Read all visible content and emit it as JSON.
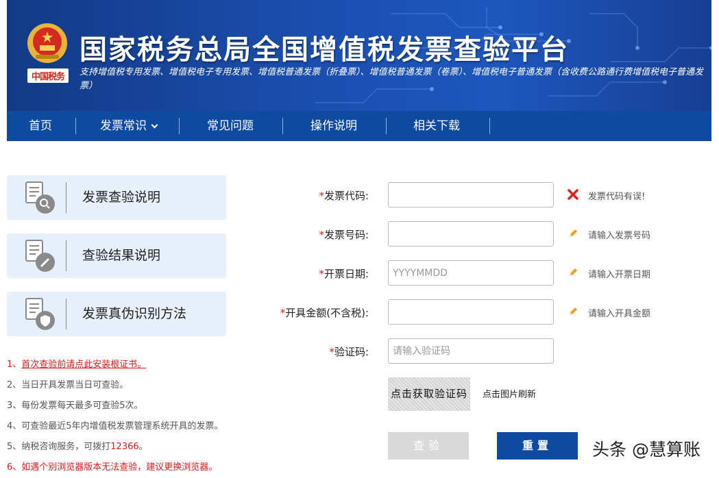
{
  "header": {
    "seal_text": "中国税务",
    "title": "国家税务总局全国增值税发票查验平台",
    "subtitle": "支持增值税专用发票、增值税电子专用发票、增值税普通发票（折叠票）、增值税普通发票（卷票）、增值税电子普通发票（含收费公路通行费增值税电子普通发票）"
  },
  "nav": {
    "items": [
      {
        "label": "首页"
      },
      {
        "label": "发票常识"
      },
      {
        "label": "常见问题"
      },
      {
        "label": "操作说明"
      },
      {
        "label": "相关下载"
      }
    ]
  },
  "sidebar": {
    "cards": [
      {
        "label": "发票查验说明",
        "icon": "document-search-icon"
      },
      {
        "label": "查验结果说明",
        "icon": "document-edit-icon"
      },
      {
        "label": "发票真伪识别方法",
        "icon": "document-shield-icon"
      }
    ]
  },
  "notes": {
    "n1_prefix": "1、",
    "n1_link": "首次查验前请点此安装根证书。",
    "n2": "2、当日开具发票当日可查验。",
    "n3": "3、每份发票每天最多可查验5次。",
    "n4": "4、可查验最近5年内增值税发票管理系统开具的发票。",
    "n5_prefix": "5、纳税咨询服务，可拨打",
    "n5_phone": "12366",
    "n5_suffix": "。",
    "n6": "6、如遇个别浏览器版本无法查验，建议更换浏览器。"
  },
  "form": {
    "star": "*",
    "invoice_code": {
      "label": "发票代码:",
      "value": "",
      "hint": "发票代码有误!",
      "hint_icon": "error-x-icon"
    },
    "invoice_number": {
      "label": "发票号码:",
      "value": "",
      "hint": "请输入发票号码",
      "hint_icon": "pencil-icon"
    },
    "issue_date": {
      "label": "开票日期:",
      "placeholder": "YYYYMMDD",
      "hint": "请输入开票日期",
      "hint_icon": "pencil-icon"
    },
    "amount": {
      "label": "开具金额(不含税):",
      "value": "",
      "hint": "请输入开具金额",
      "hint_icon": "pencil-icon"
    },
    "captcha_input": {
      "label": "验证码:",
      "placeholder": "请输入验证码"
    },
    "captcha_image_text": "点击获取验证码",
    "captcha_refresh": "点击图片刷新",
    "query_button": "查验",
    "reset_button": "重置"
  },
  "watermark": "头条 @慧算账",
  "colors": {
    "brand_blue": "#0e4a9f",
    "error_red": "#e01a1a",
    "card_bg": "#e5f0fa"
  }
}
